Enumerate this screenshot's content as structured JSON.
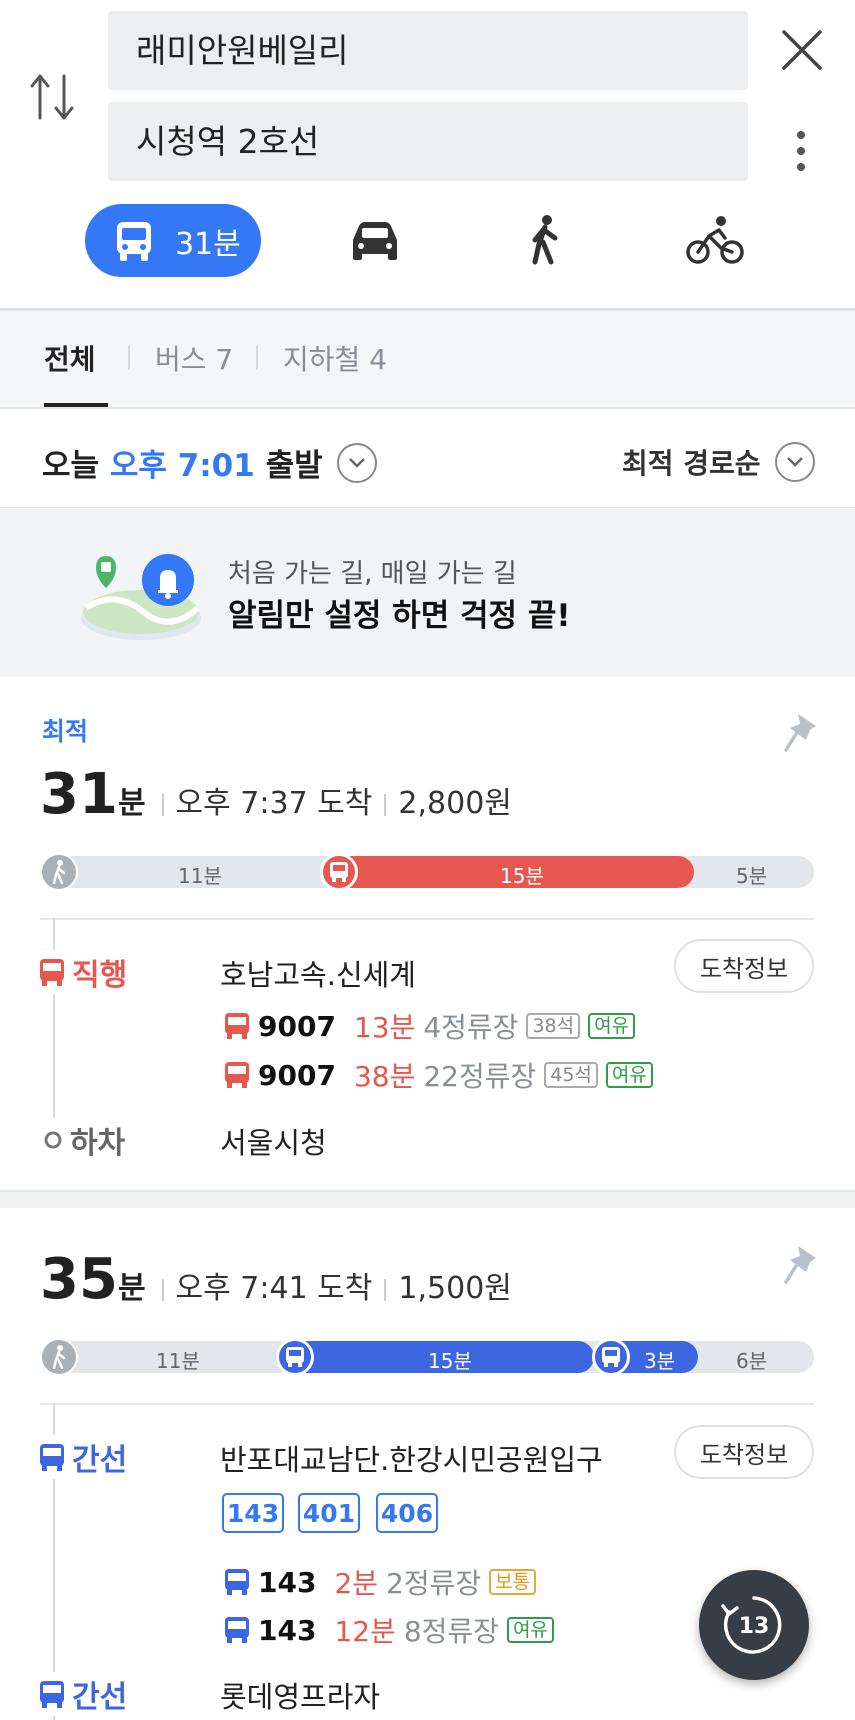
{
  "search": {
    "origin": "래미안원베일리",
    "destination": "시청역 2호선"
  },
  "modes": {
    "transit_label": "31분"
  },
  "tabs": [
    {
      "label": "전체"
    },
    {
      "label": "버스 7"
    },
    {
      "label": "지하철 4"
    }
  ],
  "depart": {
    "prefix": "오늘",
    "time": "오후 7:01",
    "suffix": "출발",
    "sort_label": "최적 경로순"
  },
  "banner": {
    "subtitle": "처음 가는 길, 매일 가는 길",
    "title": "알림만 설정 하면 걱정 끝!"
  },
  "routes": [
    {
      "tag": "최적",
      "minutes": "31",
      "minutes_unit": "분",
      "arrival": "오후 7:37 도착",
      "fare": "2,800원",
      "segments": [
        "11분",
        "15분",
        "5분"
      ],
      "legs": [
        {
          "kind": "직행",
          "stop": "호남고속.신세계",
          "arrive_btn": "도착정보",
          "buses": [
            {
              "num": "9007",
              "min": "13분",
              "stops": "4정류장",
              "seat": "38석",
              "crowd": "여유"
            },
            {
              "num": "9007",
              "min": "38분",
              "stops": "22정류장",
              "seat": "45석",
              "crowd": "여유"
            }
          ]
        }
      ],
      "alight_label": "하차",
      "alight_stop": "서울시청"
    },
    {
      "minutes": "35",
      "minutes_unit": "분",
      "arrival": "오후 7:41 도착",
      "fare": "1,500원",
      "segments": [
        "11분",
        "15분",
        "3분",
        "6분"
      ],
      "legs": [
        {
          "kind": "간선",
          "stop": "반포대교남단.한강시민공원입구",
          "arrive_btn": "도착정보",
          "chips": [
            "143",
            "401",
            "406"
          ],
          "buses": [
            {
              "num": "143",
              "min": "2분",
              "stops": "2정류장",
              "crowd": "보통"
            },
            {
              "num": "143",
              "min": "12분",
              "stops": "8정류장",
              "crowd": "여유"
            }
          ]
        },
        {
          "kind": "간선",
          "stop": "롯데영프라자"
        }
      ]
    }
  ],
  "fab": {
    "label": "13"
  },
  "colors": {
    "accent": "#3478f6",
    "express_red": "#e6584f",
    "green": "#2e9e46",
    "orange": "#e19b1c"
  }
}
